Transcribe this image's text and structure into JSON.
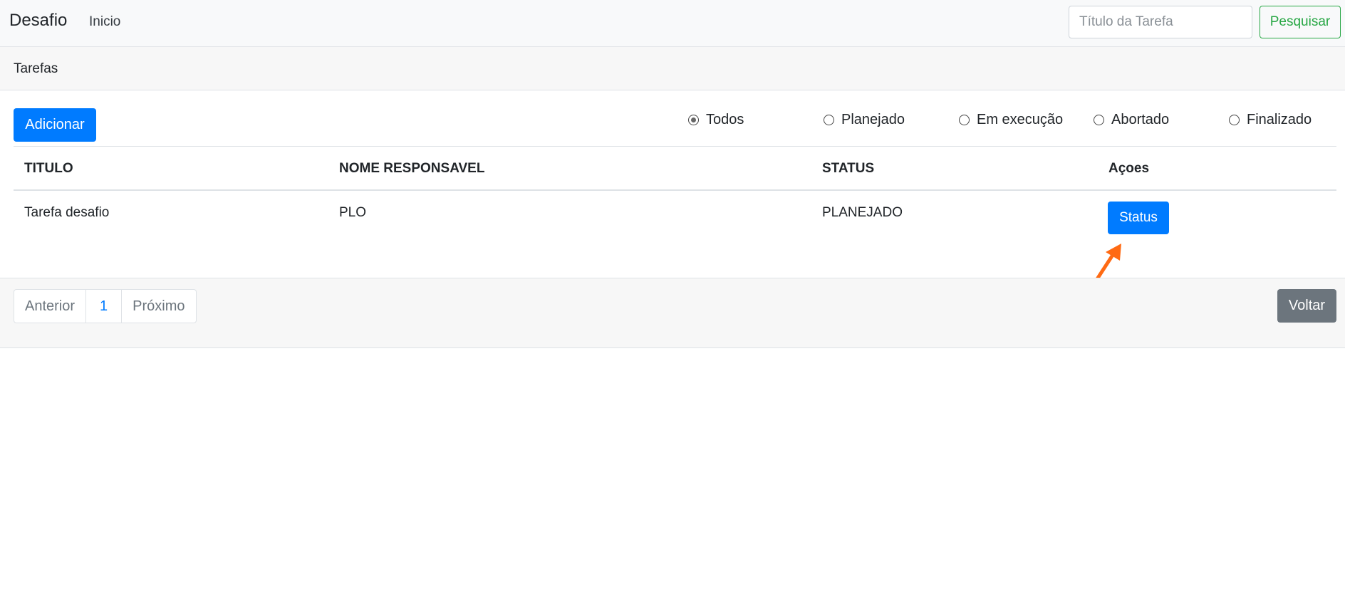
{
  "navbar": {
    "brand": "Desafio",
    "links": [
      {
        "label": "Inicio"
      }
    ],
    "search": {
      "placeholder": "Título da Tarefa",
      "value": ""
    },
    "search_button": "Pesquisar"
  },
  "card": {
    "title": "Tarefas",
    "add_button": "Adicionar",
    "filters": [
      {
        "label": "Todos",
        "checked": true
      },
      {
        "label": "Planejado",
        "checked": false
      },
      {
        "label": "Em execução",
        "checked": false
      },
      {
        "label": "Abortado",
        "checked": false
      },
      {
        "label": "Finalizado",
        "checked": false
      }
    ],
    "table": {
      "columns": [
        "TITULO",
        "NOME RESPONSAVEL",
        "STATUS",
        "Açoes"
      ],
      "rows": [
        {
          "titulo": "Tarefa desafio",
          "responsavel": "PLO",
          "status": "PLANEJADO",
          "action_label": "Status"
        }
      ]
    }
  },
  "footer": {
    "pagination": {
      "previous": "Anterior",
      "pages": [
        "1"
      ],
      "next": "Próximo"
    },
    "back_button": "Voltar"
  },
  "colors": {
    "primary": "#007bff",
    "success": "#28a745",
    "secondary": "#6c757d",
    "annotation_arrow": "#ff6a13"
  }
}
